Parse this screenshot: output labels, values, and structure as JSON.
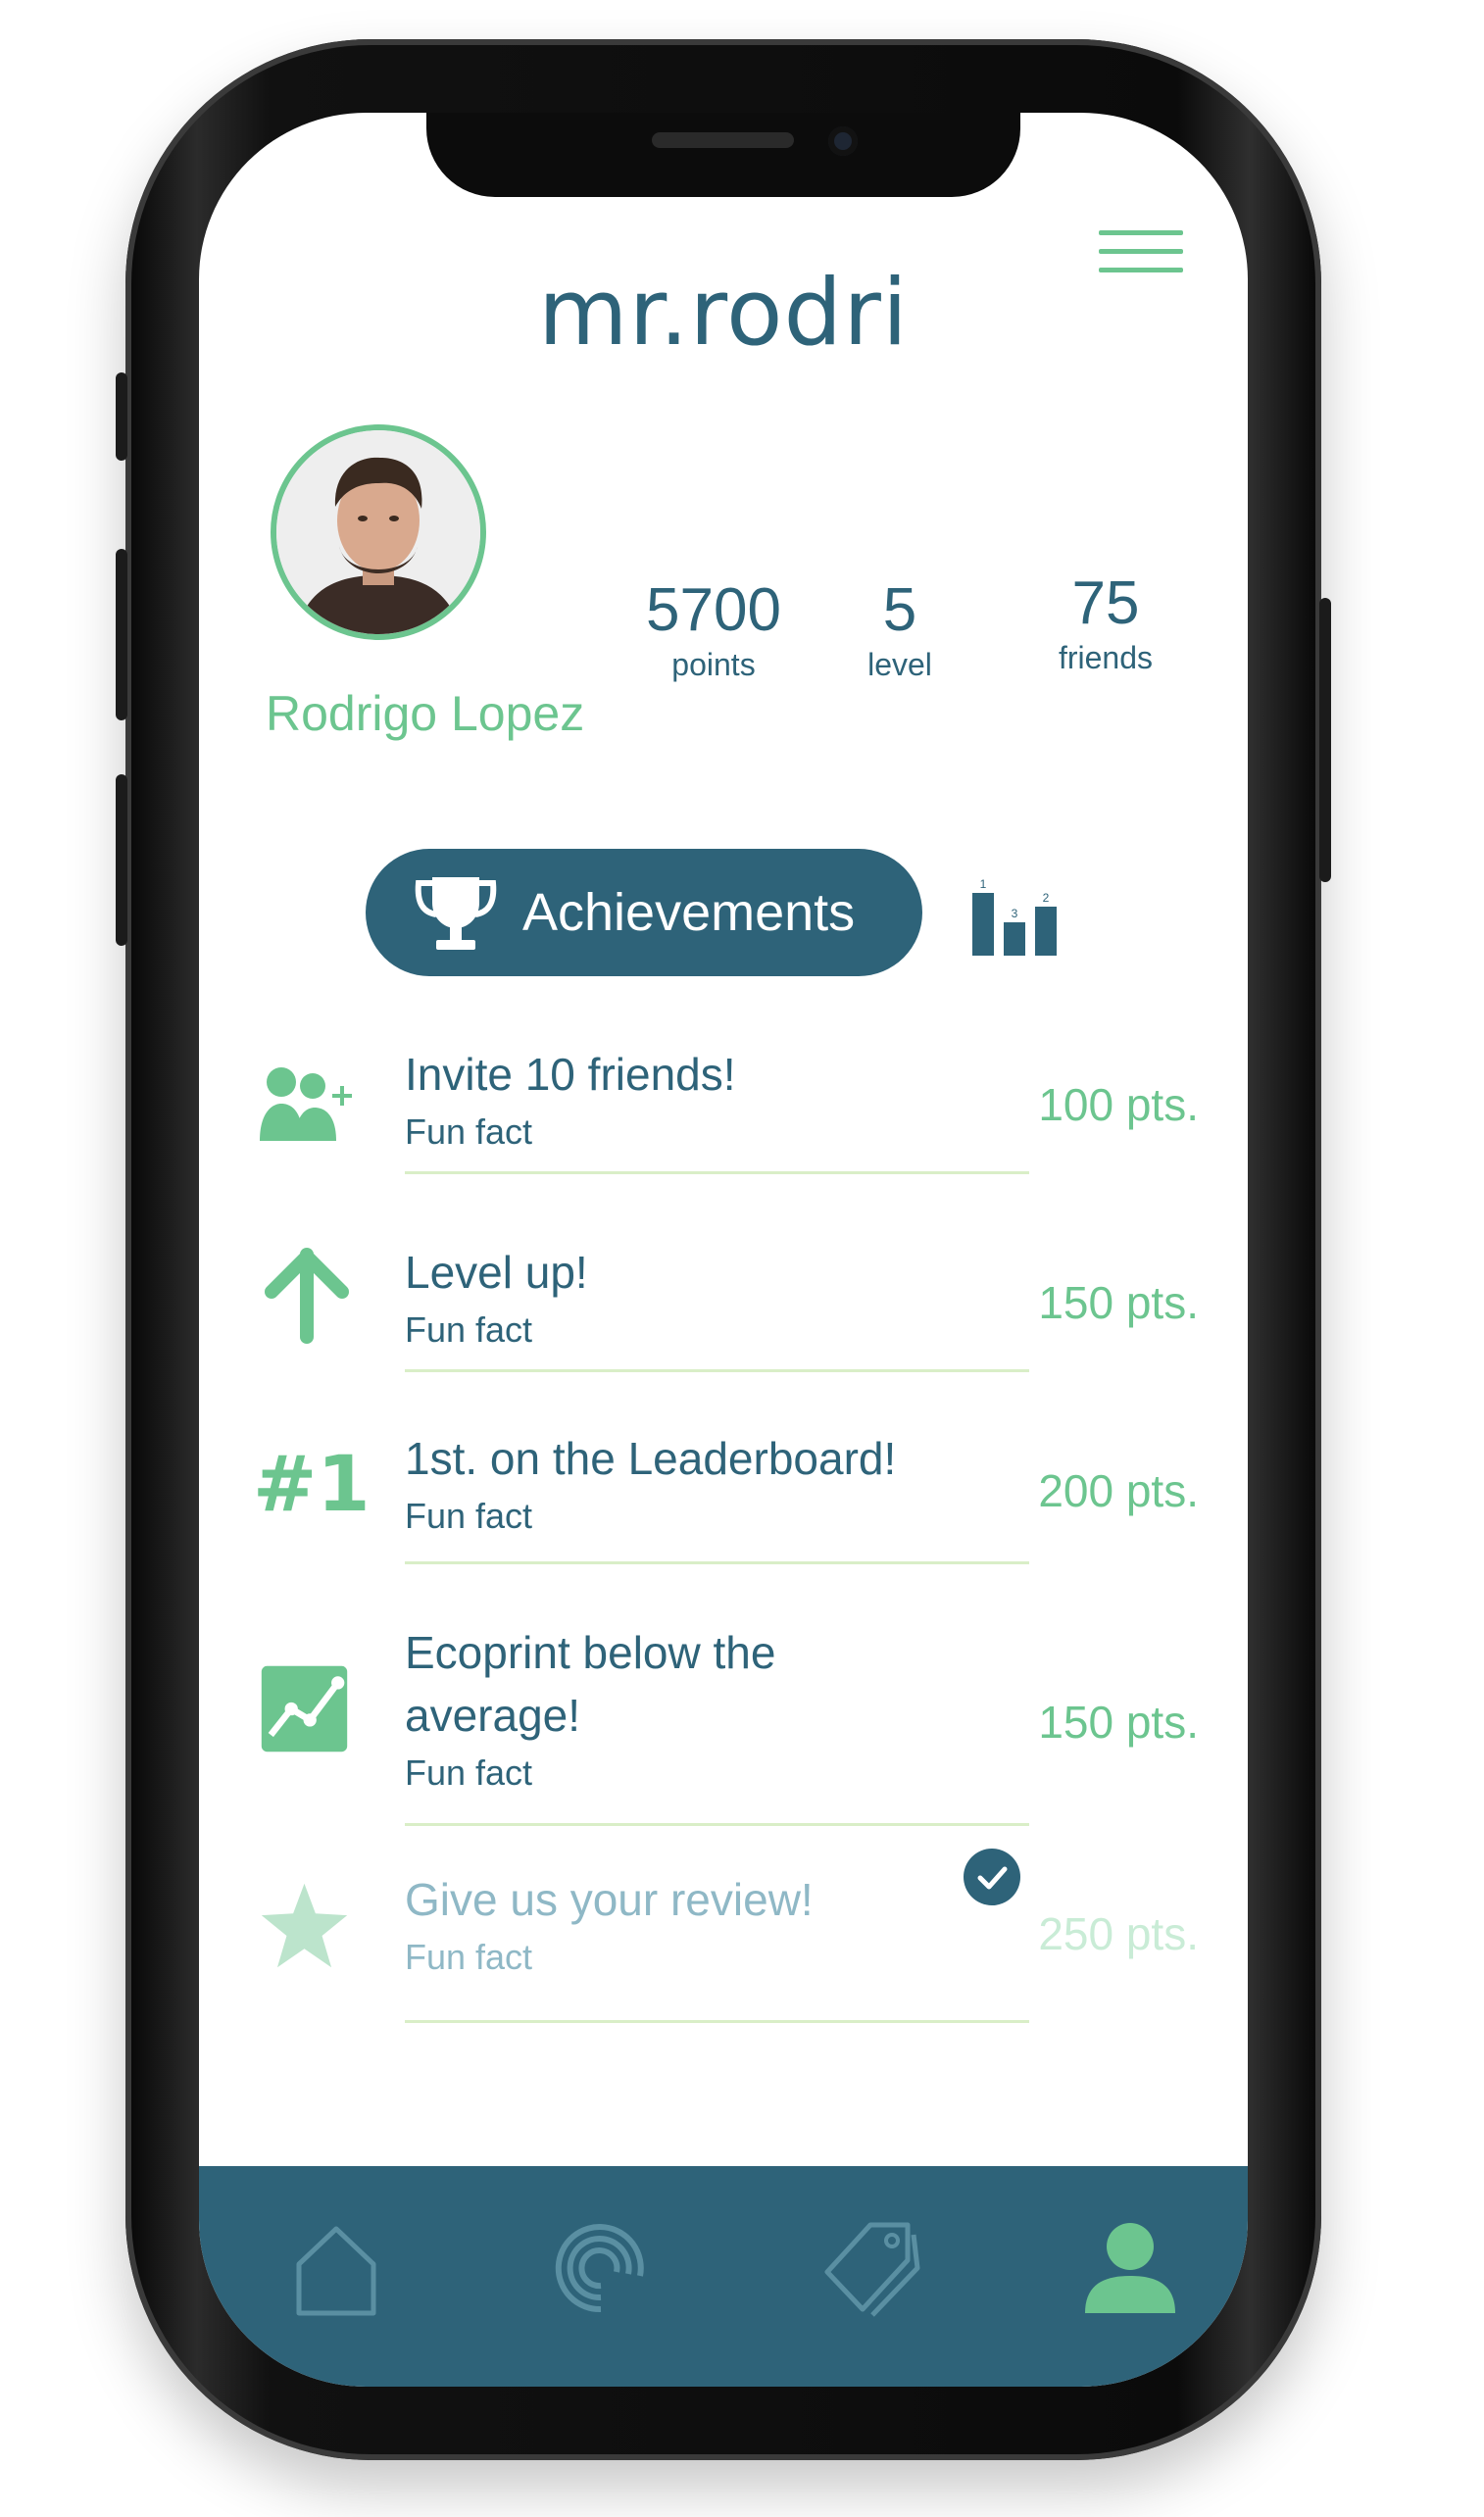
{
  "header": {
    "username": "mr.rodri"
  },
  "profile": {
    "full_name": "Rodrigo Lopez",
    "stats": [
      {
        "value": "5700",
        "label": "points"
      },
      {
        "value": "5",
        "label": "level"
      },
      {
        "value": "75",
        "label": "friends"
      }
    ]
  },
  "tabs": {
    "achievements_label": "Achievements",
    "leaderboard_podium_numbers": [
      "1",
      "3",
      "2"
    ]
  },
  "achievements": [
    {
      "title": "Invite 10 friends!",
      "subtitle": "Fun fact",
      "points": "100 pts.",
      "icon": "add-friends-icon",
      "completed": false
    },
    {
      "title": "Level up!",
      "subtitle": "Fun fact",
      "points": "150 pts.",
      "icon": "arrow-up-icon",
      "completed": false
    },
    {
      "title": "1st. on the Leaderboard!",
      "subtitle": "Fun fact",
      "points": "200 pts.",
      "icon": "number-one-icon",
      "icon_text": "#1",
      "completed": false
    },
    {
      "title": "Ecoprint below the average!",
      "subtitle": "Fun fact",
      "points": "150 pts.",
      "icon": "trend-chart-icon",
      "completed": false
    },
    {
      "title": "Give us your review!",
      "subtitle": "Fun fact",
      "points": "250 pts.",
      "icon": "star-icon",
      "completed": true
    }
  ],
  "bottom_nav": [
    {
      "name": "home",
      "icon": "home-icon",
      "active": false
    },
    {
      "name": "activity",
      "icon": "spiral-icon",
      "active": false
    },
    {
      "name": "offers",
      "icon": "tags-icon",
      "active": false
    },
    {
      "name": "profile",
      "icon": "person-icon",
      "active": true
    }
  ],
  "colors": {
    "primary": "#2e6379",
    "accent": "#6cc58f",
    "divider": "#d9eec7"
  }
}
